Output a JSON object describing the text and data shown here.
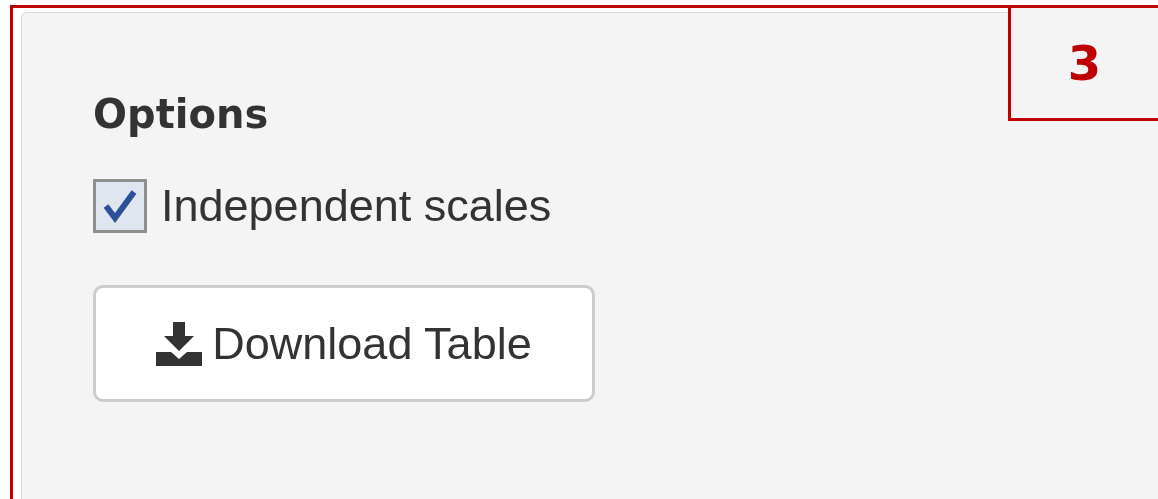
{
  "callout": {
    "label": "3"
  },
  "panel": {
    "title": "Options",
    "checkbox": {
      "label": "Independent scales",
      "checked": true
    },
    "button": {
      "label": "Download Table"
    }
  }
}
